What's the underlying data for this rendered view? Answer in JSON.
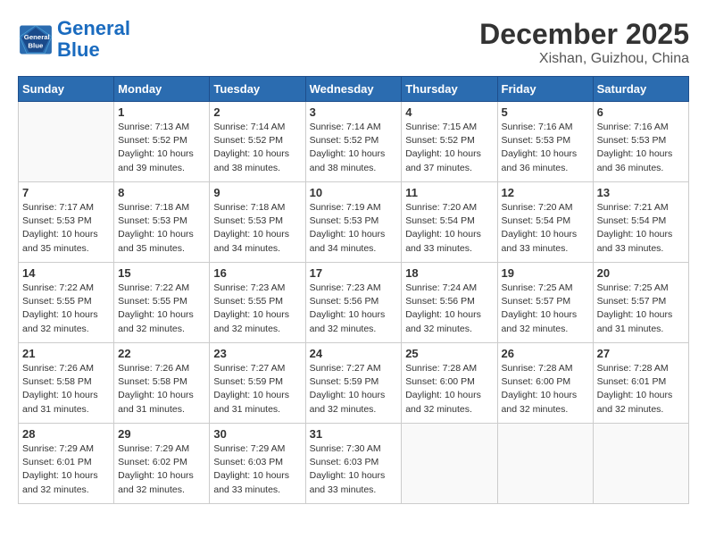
{
  "header": {
    "logo_line1": "General",
    "logo_line2": "Blue",
    "month_year": "December 2025",
    "location": "Xishan, Guizhou, China"
  },
  "days_of_week": [
    "Sunday",
    "Monday",
    "Tuesday",
    "Wednesday",
    "Thursday",
    "Friday",
    "Saturday"
  ],
  "weeks": [
    [
      {
        "day": "",
        "info": ""
      },
      {
        "day": "1",
        "info": "Sunrise: 7:13 AM\nSunset: 5:52 PM\nDaylight: 10 hours\nand 39 minutes."
      },
      {
        "day": "2",
        "info": "Sunrise: 7:14 AM\nSunset: 5:52 PM\nDaylight: 10 hours\nand 38 minutes."
      },
      {
        "day": "3",
        "info": "Sunrise: 7:14 AM\nSunset: 5:52 PM\nDaylight: 10 hours\nand 38 minutes."
      },
      {
        "day": "4",
        "info": "Sunrise: 7:15 AM\nSunset: 5:52 PM\nDaylight: 10 hours\nand 37 minutes."
      },
      {
        "day": "5",
        "info": "Sunrise: 7:16 AM\nSunset: 5:53 PM\nDaylight: 10 hours\nand 36 minutes."
      },
      {
        "day": "6",
        "info": "Sunrise: 7:16 AM\nSunset: 5:53 PM\nDaylight: 10 hours\nand 36 minutes."
      }
    ],
    [
      {
        "day": "7",
        "info": "Sunrise: 7:17 AM\nSunset: 5:53 PM\nDaylight: 10 hours\nand 35 minutes."
      },
      {
        "day": "8",
        "info": "Sunrise: 7:18 AM\nSunset: 5:53 PM\nDaylight: 10 hours\nand 35 minutes."
      },
      {
        "day": "9",
        "info": "Sunrise: 7:18 AM\nSunset: 5:53 PM\nDaylight: 10 hours\nand 34 minutes."
      },
      {
        "day": "10",
        "info": "Sunrise: 7:19 AM\nSunset: 5:53 PM\nDaylight: 10 hours\nand 34 minutes."
      },
      {
        "day": "11",
        "info": "Sunrise: 7:20 AM\nSunset: 5:54 PM\nDaylight: 10 hours\nand 33 minutes."
      },
      {
        "day": "12",
        "info": "Sunrise: 7:20 AM\nSunset: 5:54 PM\nDaylight: 10 hours\nand 33 minutes."
      },
      {
        "day": "13",
        "info": "Sunrise: 7:21 AM\nSunset: 5:54 PM\nDaylight: 10 hours\nand 33 minutes."
      }
    ],
    [
      {
        "day": "14",
        "info": "Sunrise: 7:22 AM\nSunset: 5:55 PM\nDaylight: 10 hours\nand 32 minutes."
      },
      {
        "day": "15",
        "info": "Sunrise: 7:22 AM\nSunset: 5:55 PM\nDaylight: 10 hours\nand 32 minutes."
      },
      {
        "day": "16",
        "info": "Sunrise: 7:23 AM\nSunset: 5:55 PM\nDaylight: 10 hours\nand 32 minutes."
      },
      {
        "day": "17",
        "info": "Sunrise: 7:23 AM\nSunset: 5:56 PM\nDaylight: 10 hours\nand 32 minutes."
      },
      {
        "day": "18",
        "info": "Sunrise: 7:24 AM\nSunset: 5:56 PM\nDaylight: 10 hours\nand 32 minutes."
      },
      {
        "day": "19",
        "info": "Sunrise: 7:25 AM\nSunset: 5:57 PM\nDaylight: 10 hours\nand 32 minutes."
      },
      {
        "day": "20",
        "info": "Sunrise: 7:25 AM\nSunset: 5:57 PM\nDaylight: 10 hours\nand 31 minutes."
      }
    ],
    [
      {
        "day": "21",
        "info": "Sunrise: 7:26 AM\nSunset: 5:58 PM\nDaylight: 10 hours\nand 31 minutes."
      },
      {
        "day": "22",
        "info": "Sunrise: 7:26 AM\nSunset: 5:58 PM\nDaylight: 10 hours\nand 31 minutes."
      },
      {
        "day": "23",
        "info": "Sunrise: 7:27 AM\nSunset: 5:59 PM\nDaylight: 10 hours\nand 31 minutes."
      },
      {
        "day": "24",
        "info": "Sunrise: 7:27 AM\nSunset: 5:59 PM\nDaylight: 10 hours\nand 32 minutes."
      },
      {
        "day": "25",
        "info": "Sunrise: 7:28 AM\nSunset: 6:00 PM\nDaylight: 10 hours\nand 32 minutes."
      },
      {
        "day": "26",
        "info": "Sunrise: 7:28 AM\nSunset: 6:00 PM\nDaylight: 10 hours\nand 32 minutes."
      },
      {
        "day": "27",
        "info": "Sunrise: 7:28 AM\nSunset: 6:01 PM\nDaylight: 10 hours\nand 32 minutes."
      }
    ],
    [
      {
        "day": "28",
        "info": "Sunrise: 7:29 AM\nSunset: 6:01 PM\nDaylight: 10 hours\nand 32 minutes."
      },
      {
        "day": "29",
        "info": "Sunrise: 7:29 AM\nSunset: 6:02 PM\nDaylight: 10 hours\nand 32 minutes."
      },
      {
        "day": "30",
        "info": "Sunrise: 7:29 AM\nSunset: 6:03 PM\nDaylight: 10 hours\nand 33 minutes."
      },
      {
        "day": "31",
        "info": "Sunrise: 7:30 AM\nSunset: 6:03 PM\nDaylight: 10 hours\nand 33 minutes."
      },
      {
        "day": "",
        "info": ""
      },
      {
        "day": "",
        "info": ""
      },
      {
        "day": "",
        "info": ""
      }
    ]
  ]
}
